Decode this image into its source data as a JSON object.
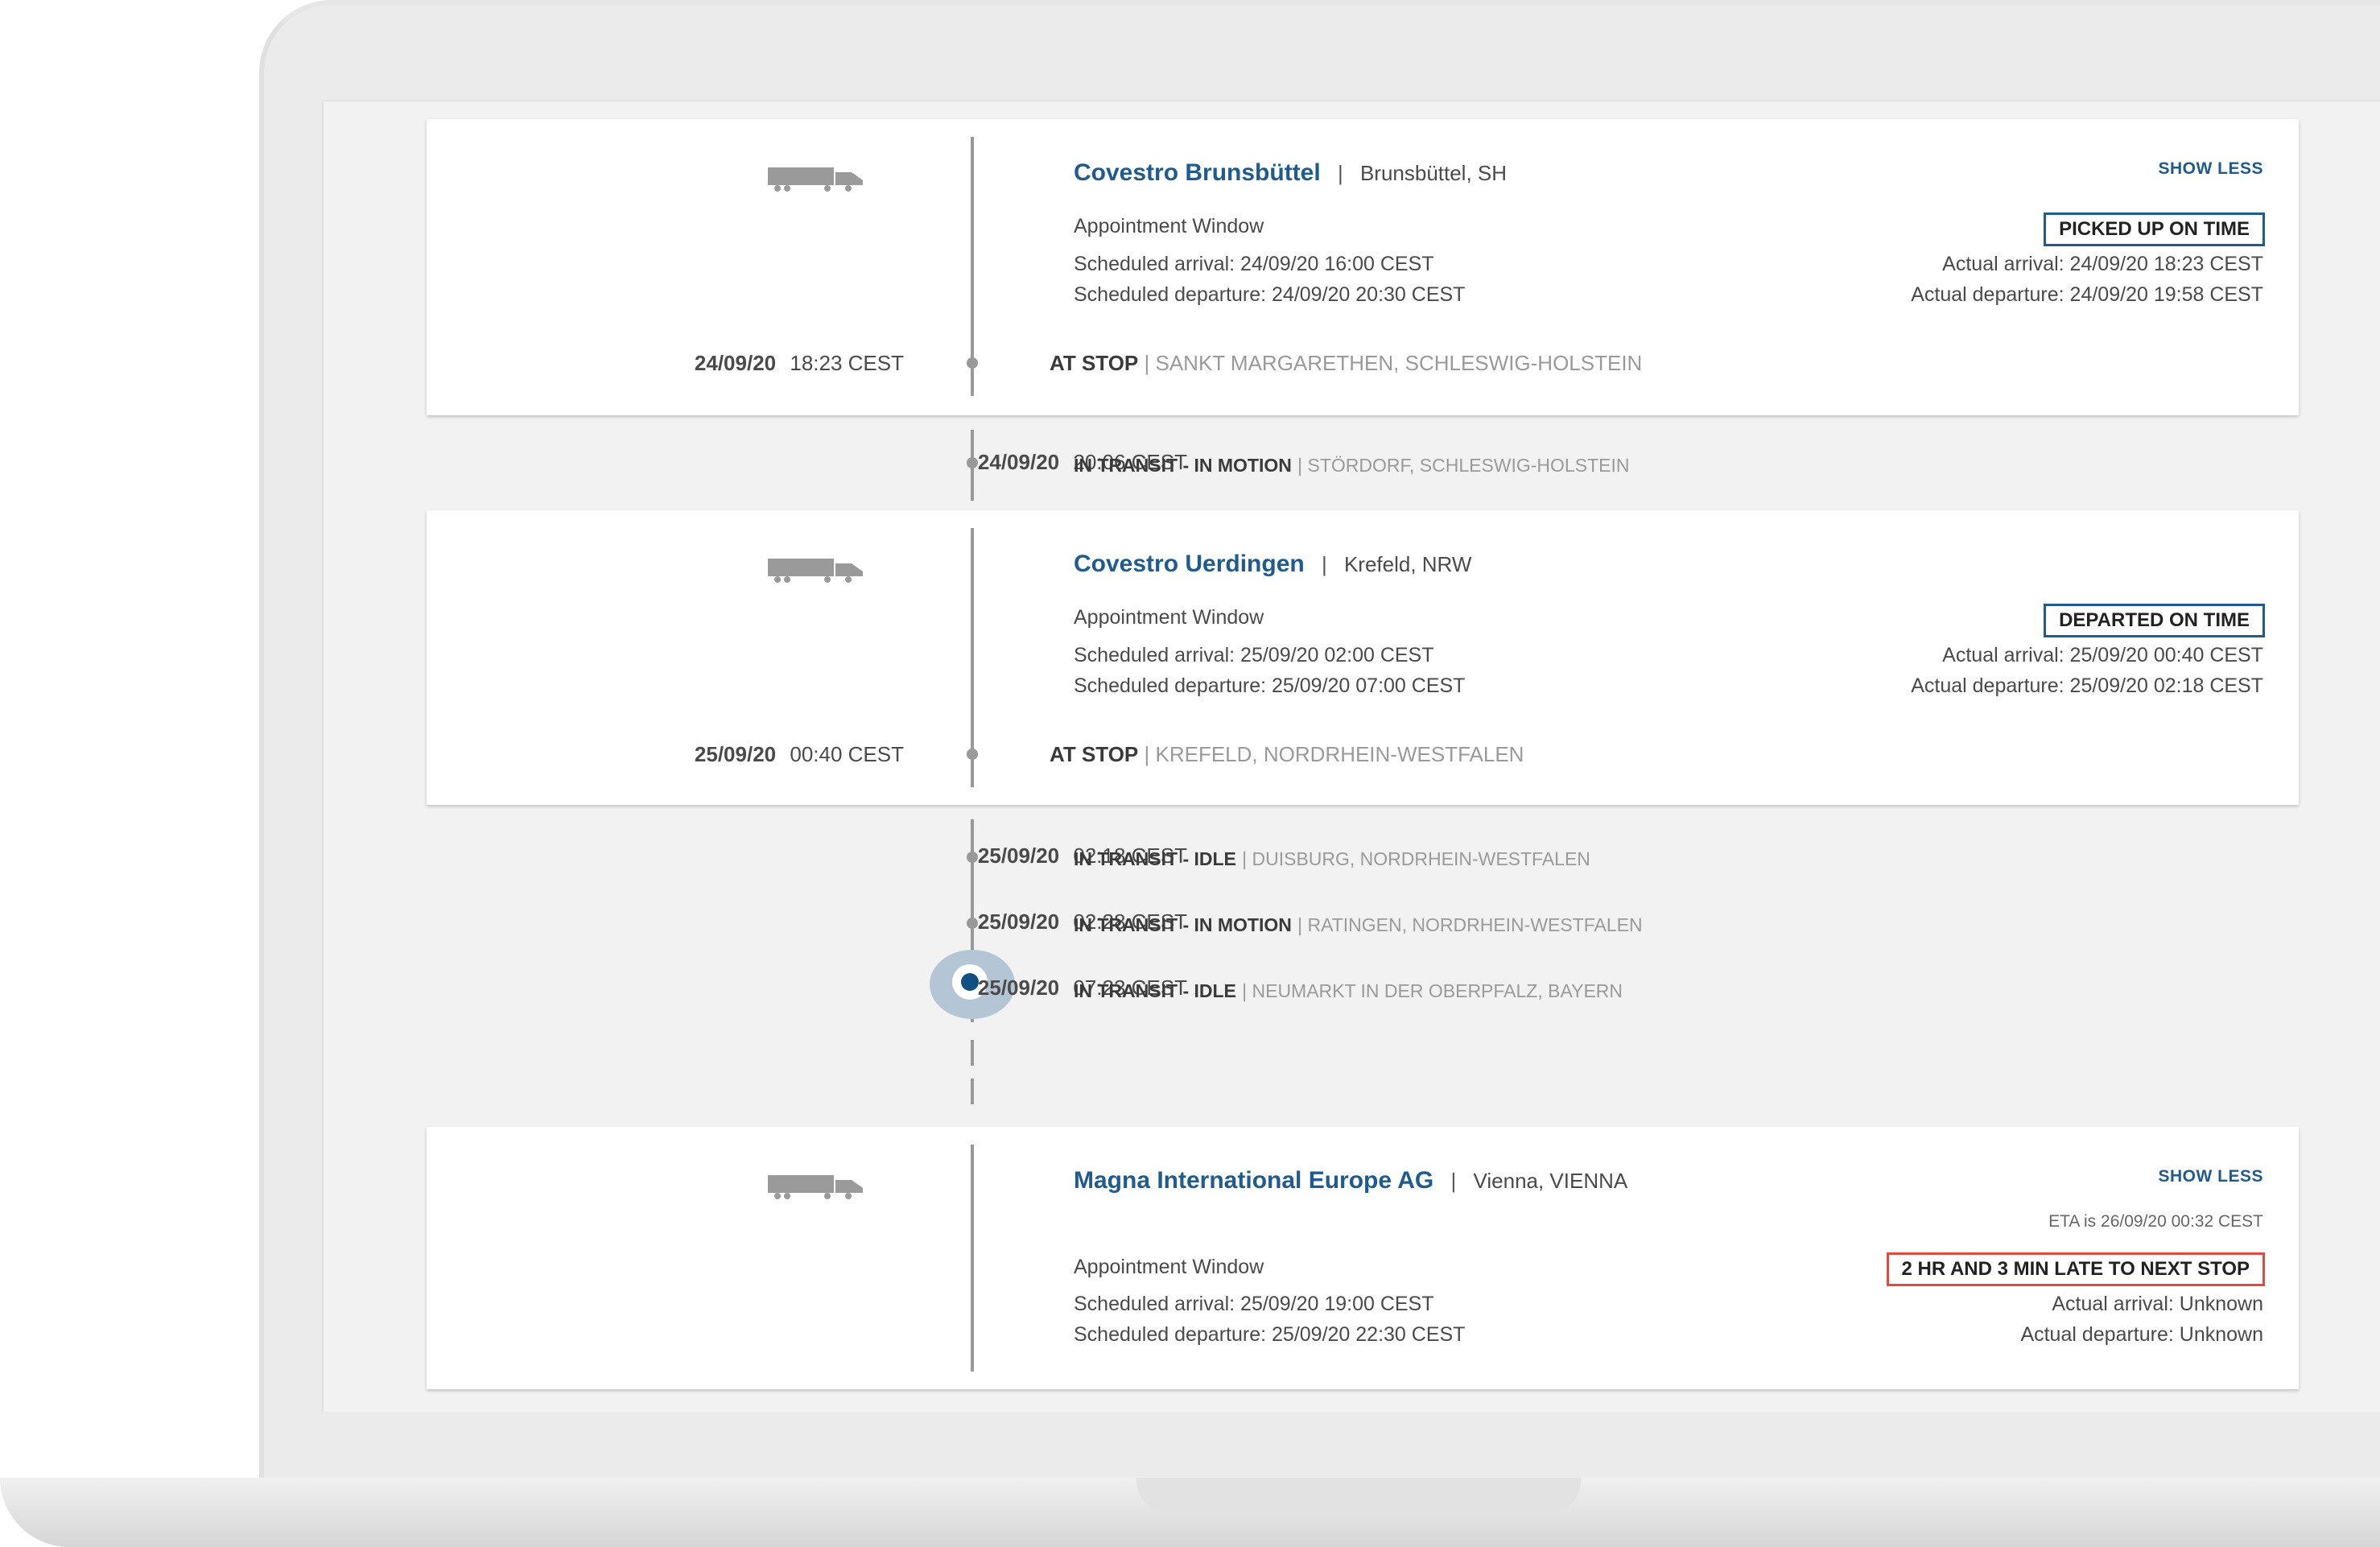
{
  "colors": {
    "accent": "#1f5b8e",
    "late": "#e04a3f",
    "timeline": "#999999",
    "current_marker": "#b4c6d6"
  },
  "icons": {
    "stop": "truck-icon",
    "current": "current-location-icon"
  },
  "stops": [
    {
      "name": "Covestro Brunsbüttel",
      "separator": "|",
      "location": "Brunsbüttel, SH",
      "toggle": "SHOW LESS",
      "window_label": "Appointment Window",
      "scheduled_arrival": "Scheduled arrival: 24/09/20 16:00 CEST",
      "scheduled_departure": "Scheduled departure: 24/09/20 20:30 CEST",
      "status": "PICKED UP ON TIME",
      "actual_arrival": "Actual arrival: 24/09/20 18:23 CEST",
      "actual_departure": "Actual departure: 24/09/20 19:58 CEST",
      "event_date": "24/09/20",
      "event_time": "18:23 CEST",
      "event_type": "AT STOP",
      "event_location": "| SANKT MARGARETHEN, SCHLESWIG-HOLSTEIN"
    },
    {
      "name": "Covestro Uerdingen",
      "separator": "|",
      "location": "Krefeld, NRW",
      "window_label": "Appointment Window",
      "scheduled_arrival": "Scheduled arrival: 25/09/20 02:00 CEST",
      "scheduled_departure": "Scheduled departure: 25/09/20 07:00 CEST",
      "status": "DEPARTED ON TIME",
      "actual_arrival": "Actual arrival: 25/09/20 00:40 CEST",
      "actual_departure": "Actual departure: 25/09/20 02:18 CEST",
      "event_date": "25/09/20",
      "event_time": "00:40 CEST",
      "event_type": "AT STOP",
      "event_location": "| KREFELD, NORDRHEIN-WESTFALEN"
    },
    {
      "name": "Magna International Europe AG",
      "separator": "|",
      "location": "Vienna, VIENNA",
      "toggle": "SHOW LESS",
      "eta": "ETA is 26/09/20 00:32 CEST",
      "window_label": "Appointment Window",
      "scheduled_arrival": "Scheduled arrival: 25/09/20 19:00 CEST",
      "scheduled_departure": "Scheduled departure: 25/09/20 22:30 CEST",
      "status": "2 HR AND 3 MIN LATE TO NEXT STOP",
      "actual_arrival": "Actual arrival: Unknown",
      "actual_departure": "Actual departure: Unknown"
    }
  ],
  "transit_events": [
    {
      "date": "24/09/20",
      "time": "20:06 CEST",
      "type": "IN TRANSIT - IN MOTION",
      "location": "| STÖRDORF, SCHLESWIG-HOLSTEIN"
    },
    {
      "date": "25/09/20",
      "time": "02:18 CEST",
      "type": "IN TRANSIT - IDLE",
      "location": "| DUISBURG, NORDRHEIN-WESTFALEN"
    },
    {
      "date": "25/09/20",
      "time": "02:28 CEST",
      "type": "IN TRANSIT - IN MOTION",
      "location": "| RATINGEN, NORDRHEIN-WESTFALEN"
    },
    {
      "date": "25/09/20",
      "time": "07:23 CEST",
      "type": "IN TRANSIT - IDLE",
      "location": "| NEUMARKT IN DER OBERPFALZ, BAYERN"
    }
  ]
}
